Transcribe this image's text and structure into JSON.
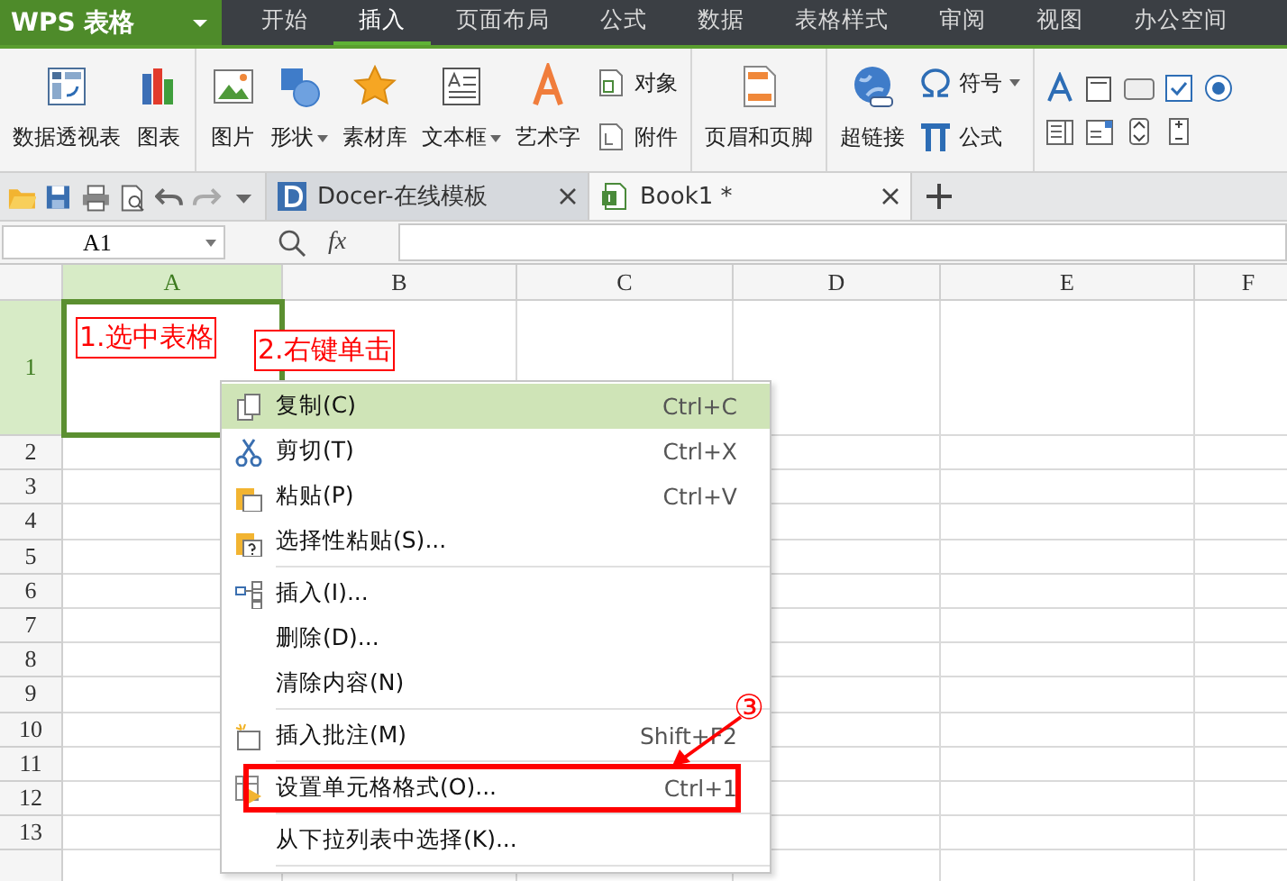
{
  "app": {
    "logo": "WPS 表格"
  },
  "menu_tabs": [
    {
      "label": "开始",
      "selected": false
    },
    {
      "label": "插入",
      "selected": true
    },
    {
      "label": "页面布局",
      "selected": false
    },
    {
      "label": "公式",
      "selected": false
    },
    {
      "label": "数据",
      "selected": false
    },
    {
      "label": "表格样式",
      "selected": false
    },
    {
      "label": "审阅",
      "selected": false
    },
    {
      "label": "视图",
      "selected": false
    },
    {
      "label": "办公空间",
      "selected": false
    }
  ],
  "ribbon": {
    "groups": [
      {
        "items": [
          {
            "kind": "large",
            "label": "数据透视表",
            "dropdown": false
          },
          {
            "kind": "large",
            "label": "图表",
            "dropdown": false
          }
        ]
      },
      {
        "items": [
          {
            "kind": "large",
            "label": "图片",
            "dropdown": false
          },
          {
            "kind": "large",
            "label": "形状",
            "dropdown": true
          },
          {
            "kind": "large",
            "label": "素材库",
            "dropdown": false
          },
          {
            "kind": "large",
            "label": "文本框",
            "dropdown": true
          },
          {
            "kind": "large",
            "label": "艺术字",
            "dropdown": false
          },
          {
            "kind": "small",
            "label": "对象",
            "dropdown": false
          },
          {
            "kind": "small",
            "label": "附件",
            "dropdown": false
          }
        ]
      },
      {
        "items": [
          {
            "kind": "large",
            "label": "页眉和页脚",
            "dropdown": false
          }
        ]
      },
      {
        "items": [
          {
            "kind": "large",
            "label": "超链接",
            "dropdown": false
          },
          {
            "kind": "small",
            "label": "符号",
            "dropdown": true
          },
          {
            "kind": "small",
            "label": "公式",
            "dropdown": false
          }
        ]
      },
      {
        "items": [
          {
            "kind": "controls"
          }
        ]
      }
    ]
  },
  "doc_tabs": [
    {
      "title": "Docer-在线模板",
      "selected": false
    },
    {
      "title": "Book1 *",
      "selected": true
    }
  ],
  "formula_bar": {
    "name_box": "A1",
    "fx": "fx"
  },
  "sheet": {
    "columns": [
      {
        "label": "A",
        "selected": true
      },
      {
        "label": "B",
        "selected": false
      },
      {
        "label": "C",
        "selected": false
      },
      {
        "label": "D",
        "selected": false
      },
      {
        "label": "E",
        "selected": false
      },
      {
        "label": "F",
        "selected": false
      }
    ],
    "rows": [
      {
        "label": "1",
        "selected": true
      },
      {
        "label": "2",
        "selected": false
      },
      {
        "label": "3",
        "selected": false
      },
      {
        "label": "4",
        "selected": false
      },
      {
        "label": "5",
        "selected": false
      },
      {
        "label": "6",
        "selected": false
      },
      {
        "label": "7",
        "selected": false
      },
      {
        "label": "8",
        "selected": false
      },
      {
        "label": "9",
        "selected": false
      },
      {
        "label": "10",
        "selected": false
      },
      {
        "label": "11",
        "selected": false
      },
      {
        "label": "12",
        "selected": false
      },
      {
        "label": "13",
        "selected": false
      }
    ],
    "notes": [
      {
        "text": "1.选中表格"
      },
      {
        "text": "2.右键单击"
      }
    ],
    "step_marker": "③"
  },
  "context_menu": {
    "items": [
      {
        "kind": "item",
        "label": "复制(C)",
        "shortcut": "Ctrl+C",
        "highlighted": true,
        "marked": false
      },
      {
        "kind": "item",
        "label": "剪切(T)",
        "shortcut": "Ctrl+X",
        "highlighted": false,
        "marked": false
      },
      {
        "kind": "item",
        "label": "粘贴(P)",
        "shortcut": "Ctrl+V",
        "highlighted": false,
        "marked": false
      },
      {
        "kind": "item",
        "label": "选择性粘贴(S)...",
        "highlighted": false,
        "marked": false
      },
      {
        "kind": "separator"
      },
      {
        "kind": "item",
        "label": "插入(I)...",
        "highlighted": false,
        "marked": false
      },
      {
        "kind": "item",
        "label": "删除(D)...",
        "highlighted": false,
        "marked": false
      },
      {
        "kind": "item",
        "label": "清除内容(N)",
        "highlighted": false,
        "marked": false
      },
      {
        "kind": "separator"
      },
      {
        "kind": "item",
        "label": "插入批注(M)",
        "shortcut": "Shift+F2",
        "highlighted": false,
        "marked": false
      },
      {
        "kind": "separator"
      },
      {
        "kind": "item",
        "label": "设置单元格格式(O)...",
        "shortcut": "Ctrl+1",
        "highlighted": false,
        "marked": true
      },
      {
        "kind": "separator"
      },
      {
        "kind": "item",
        "label": "从下拉列表中选择(K)...",
        "highlighted": false,
        "marked": false
      },
      {
        "kind": "separator"
      }
    ]
  }
}
